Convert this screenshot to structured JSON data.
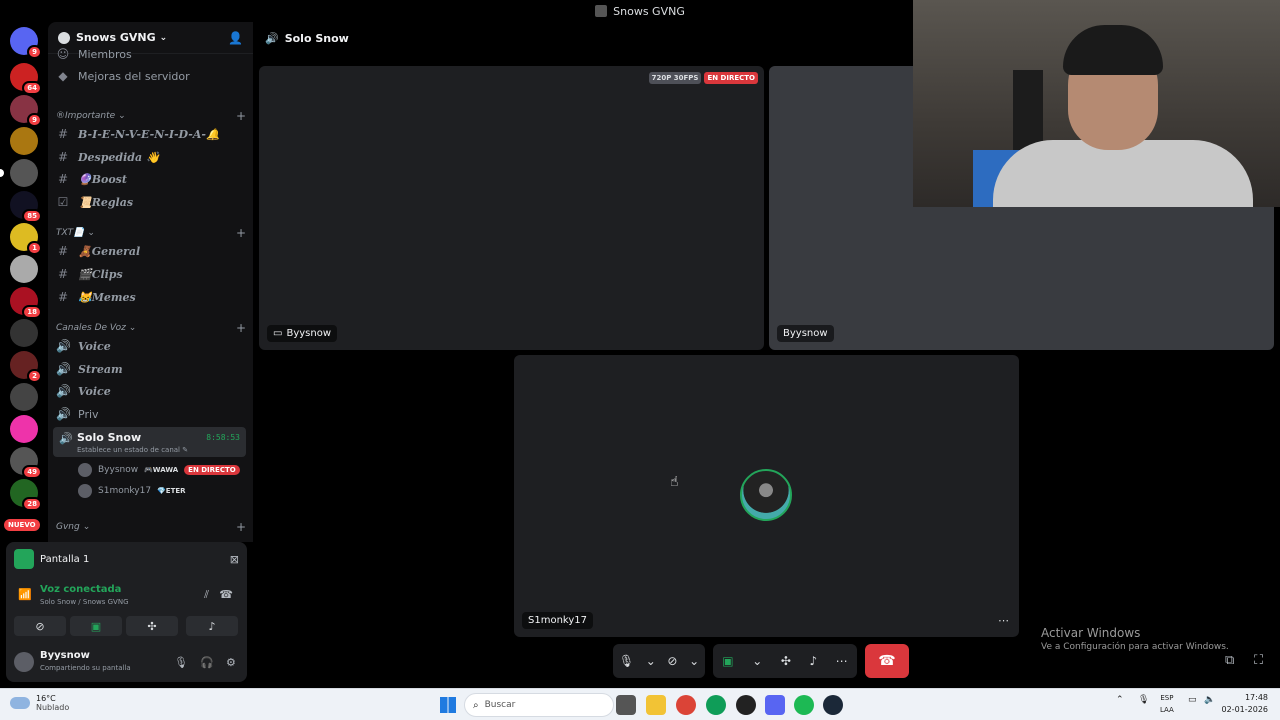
{
  "window": {
    "title": "Snows GVNG"
  },
  "server_rail": {
    "badges": [
      "9",
      "64",
      "9",
      "85",
      "1",
      "18",
      "2",
      "49",
      "28"
    ],
    "new_label": "NUEVO"
  },
  "sidebar": {
    "server_name": "Snows GVNG",
    "items": [
      {
        "icon": "users-icon",
        "label": "Miembros"
      },
      {
        "icon": "boost-icon",
        "label": "Mejoras del servidor"
      }
    ],
    "categories": {
      "importante": "®Importante",
      "txt": "TXT📄",
      "voz": "Canales De Voz",
      "gvng": "Gvng"
    },
    "channels": {
      "bienvenida": "B-I-E-N-V-E-N-I-D-A-🔔",
      "despedida": "Despedida 👋",
      "boost": "🔮Boost",
      "reglas": "📜Reglas",
      "general": "🧸General",
      "clips": "🎬Clips",
      "memes": "😹Memes",
      "voice1": "Voice",
      "stream": "Stream",
      "voice2": "Voice",
      "priv": "Priv"
    },
    "active_channel": {
      "name": "Solo Snow",
      "status_hint": "Establece un estado de canal ✎",
      "timer": "8:58:53"
    },
    "members": [
      {
        "name": "Byysnow",
        "tag": "🎮WAWA",
        "live": "EN DIRECTO"
      },
      {
        "name": "S1monky17",
        "tag": "💎ETER",
        "live": ""
      }
    ]
  },
  "panel": {
    "screen_label": "Pantalla 1",
    "voice_status": "Voz conectada",
    "voice_location": "Solo Snow / Snows GVNG",
    "user_name": "Byysnow",
    "user_status": "Compartiendo su pantalla"
  },
  "main": {
    "channel_title": "Solo Snow",
    "tiles": [
      {
        "label": "Byysnow",
        "quality": "720P 30FPS",
        "live": "EN DIRECTO"
      },
      {
        "label": "Byysnow"
      },
      {
        "label": "S1monky17"
      }
    ]
  },
  "watermark": {
    "line1": "Activar Windows",
    "line2": "Ve a Configuración para activar Windows."
  },
  "taskbar": {
    "weather_temp": "16°C",
    "weather_desc": "Nublado",
    "search_placeholder": "Buscar",
    "lang_1": "ESP",
    "lang_2": "LAA",
    "time": "17:48",
    "date": "02-01-2026"
  },
  "colors": {
    "accent_green": "#23a55a",
    "live_red": "#da373c",
    "hangup_red": "#da373c",
    "sidebar_bg": "#121214"
  }
}
